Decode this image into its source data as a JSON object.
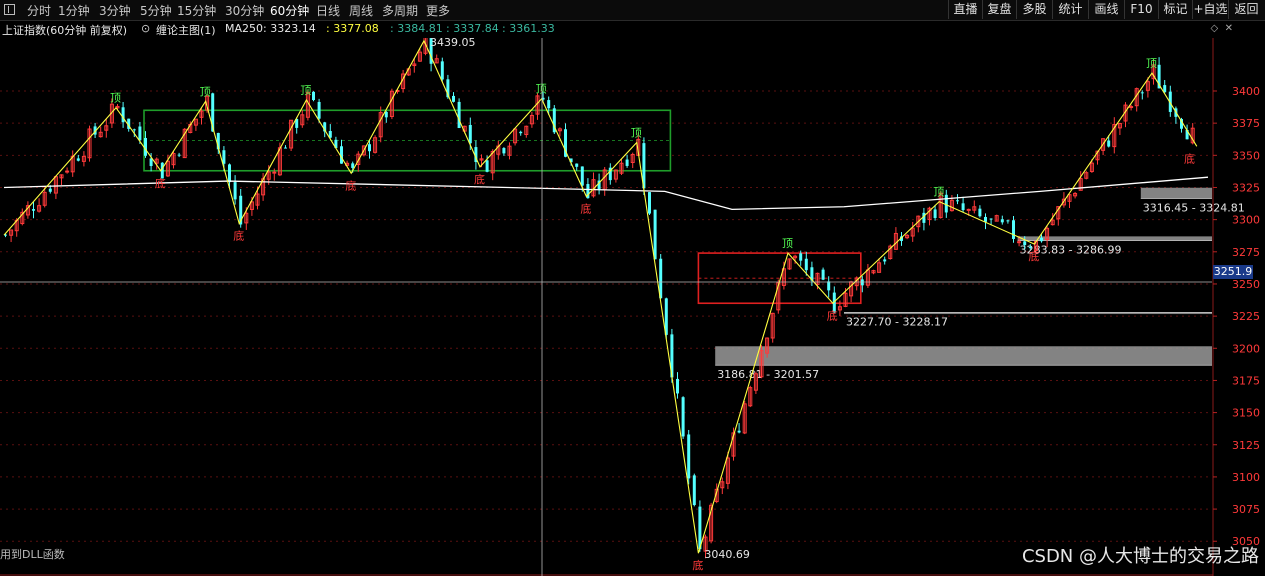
{
  "toolbar": {
    "periods": [
      "分时",
      "1分钟",
      "3分钟",
      "5分钟",
      "15分钟",
      "30分钟",
      "60分钟",
      "日线",
      "周线",
      "多周期",
      "更多"
    ],
    "active_period": "60分钟",
    "buttons": [
      "直播",
      "复盘",
      "多股",
      "统计",
      "画线",
      "F10",
      "标记",
      "+自选",
      "返回"
    ]
  },
  "infobar": {
    "title": "上证指数(60分钟 前复权)",
    "indicator": "缠论主图(1)",
    "ma_label": "MA250: 3323.14",
    "v1": ": 3377.08",
    "v2": ": 3384.81",
    "v3": ": 3337.84",
    "v4": ": 3361.33"
  },
  "price_axis": {
    "ticks": [
      3400,
      3375,
      3350,
      3325,
      3300,
      3275,
      3250,
      3225,
      3200,
      3175,
      3150,
      3125,
      3100,
      3075,
      3050
    ],
    "min": 3047,
    "max": 3437,
    "current_price": "3251.9"
  },
  "annotations": {
    "high": "3439.05",
    "low": "3040.69",
    "zones": [
      "3316.45 - 3324.81",
      "3283.83 - 3286.99",
      "3227.70 - 3228.17",
      "3186.81 - 3201.57"
    ]
  },
  "fractals": {
    "top": "顶",
    "bottom": "底"
  },
  "misc": {
    "dll_text": "用到DLL函数",
    "watermark": "CSDN @人大博士的交易之路"
  },
  "colors": {
    "up": "#ff3a3a",
    "down": "#54ffff",
    "ma": "#ffffff",
    "stroke": "#ffff40",
    "hub1": "#1f9d2a",
    "hub2": "#e02020",
    "zone": "#9a9a9a"
  },
  "chart_data": {
    "type": "candlestick",
    "bar_count": 210,
    "bi_points": [
      {
        "bar": 0,
        "price": 3288,
        "kind": "low"
      },
      {
        "bar": 20,
        "price": 3387,
        "kind": "top"
      },
      {
        "bar": 28,
        "price": 3338,
        "kind": "bottom"
      },
      {
        "bar": 36,
        "price": 3392,
        "kind": "top"
      },
      {
        "bar": 42,
        "price": 3297,
        "kind": "bottom"
      },
      {
        "bar": 54,
        "price": 3393,
        "kind": "top"
      },
      {
        "bar": 62,
        "price": 3336,
        "kind": "bottom"
      },
      {
        "bar": 75,
        "price": 3439.05,
        "kind": "top"
      },
      {
        "bar": 85,
        "price": 3341,
        "kind": "bottom"
      },
      {
        "bar": 96,
        "price": 3394,
        "kind": "top"
      },
      {
        "bar": 104,
        "price": 3318,
        "kind": "bottom"
      },
      {
        "bar": 113,
        "price": 3360,
        "kind": "top"
      },
      {
        "bar": 124,
        "price": 3040.69,
        "kind": "bottom"
      },
      {
        "bar": 140,
        "price": 3274,
        "kind": "top"
      },
      {
        "bar": 148,
        "price": 3235,
        "kind": "bottom"
      },
      {
        "bar": 167,
        "price": 3314,
        "kind": "top"
      },
      {
        "bar": 184,
        "price": 3281,
        "kind": "bottom"
      },
      {
        "bar": 205,
        "price": 3414,
        "kind": "top"
      },
      {
        "bar": 213,
        "price": 3357,
        "kind": "bottom"
      }
    ],
    "hubs": [
      {
        "from_bar": 25,
        "to_bar": 119,
        "low": 3338,
        "high": 3385,
        "color": "#1f9d2a"
      },
      {
        "from_bar": 124,
        "to_bar": 153,
        "low": 3235,
        "high": 3274,
        "color": "#e02020"
      }
    ],
    "zones": [
      {
        "label": "3316.45 - 3324.81",
        "low": 3316.45,
        "high": 3324.81
      },
      {
        "label": "3283.83 - 3286.99",
        "low": 3283.83,
        "high": 3286.99
      },
      {
        "label": "3227.70 - 3228.17",
        "low": 3227.7,
        "high": 3228.17
      },
      {
        "label": "3186.81 - 3201.57",
        "low": 3186.81,
        "high": 3201.57
      }
    ],
    "ma250": [
      {
        "bar": 0,
        "price": 3325
      },
      {
        "bar": 40,
        "price": 3330
      },
      {
        "bar": 90,
        "price": 3325
      },
      {
        "bar": 118,
        "price": 3322
      },
      {
        "bar": 130,
        "price": 3308
      },
      {
        "bar": 150,
        "price": 3310
      },
      {
        "bar": 185,
        "price": 3322
      },
      {
        "bar": 215,
        "price": 3333
      }
    ]
  }
}
